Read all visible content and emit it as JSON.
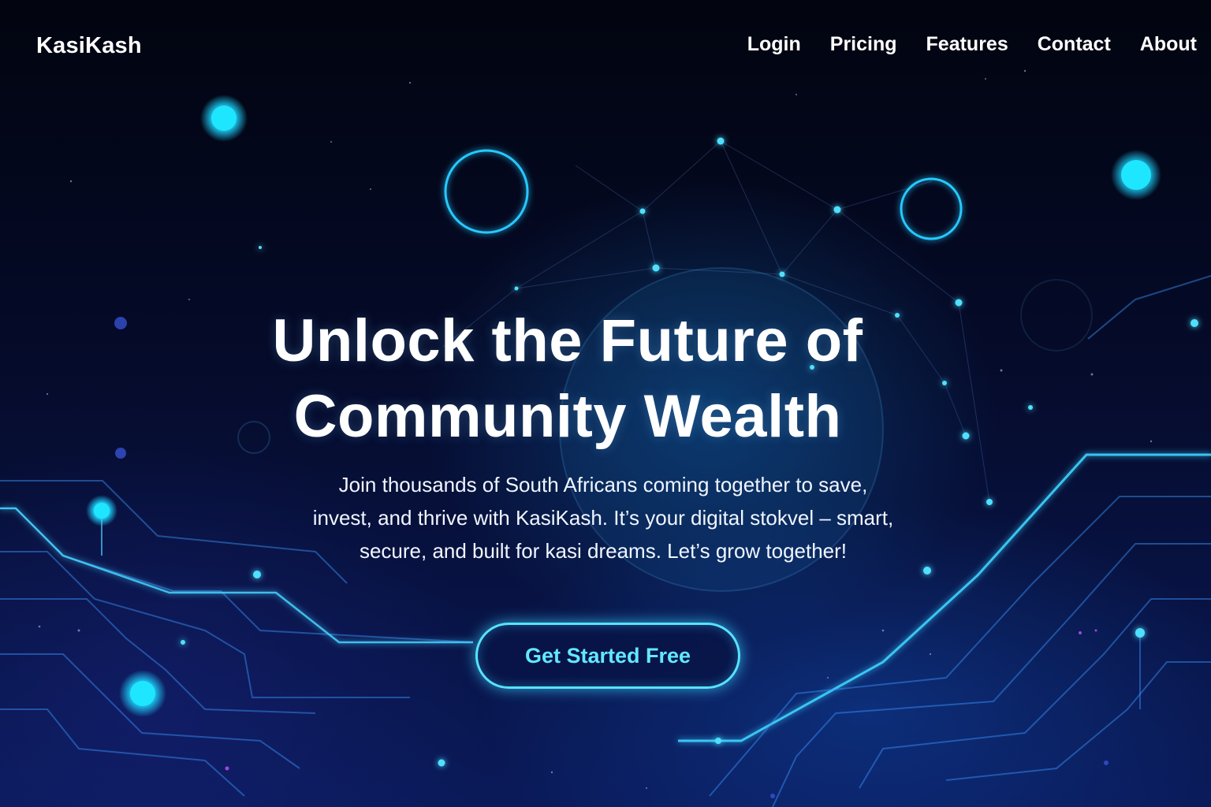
{
  "brand": {
    "name": "KasiKash"
  },
  "nav": {
    "links": [
      "Login",
      "Pricing",
      "Features",
      "Contact",
      "About"
    ]
  },
  "hero": {
    "title_line1": "Unlock the Future of",
    "title_line2": "Community Wealth",
    "subtitle_line1": "Join thousands of South Africans coming together to save,",
    "subtitle_line2": "invest, and thrive with KasiKash. It’s your digital stokvel – smart,",
    "subtitle_line3": "secure, and built for kasi dreams. Let’s grow together!",
    "cta_label": "Get Started Free"
  },
  "colors": {
    "background": "#03061a",
    "accent": "#56e3ff",
    "text": "#ffffff"
  }
}
